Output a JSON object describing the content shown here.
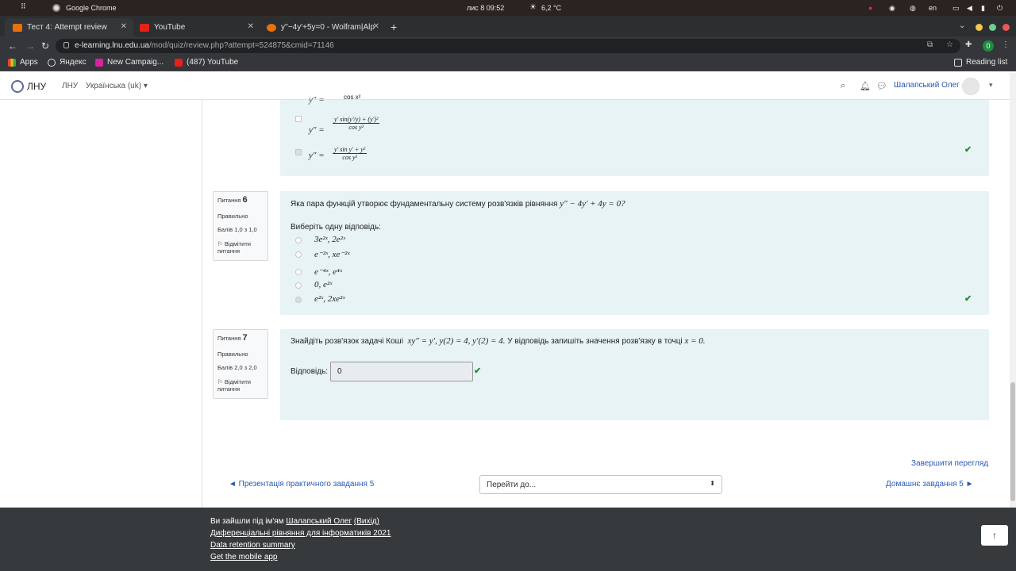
{
  "os": {
    "apps_label": "Google Chrome",
    "clock": "лис 8  09:52",
    "temp": "6,2 °C",
    "lang": "en"
  },
  "tabs": [
    {
      "title": "Тест 4: Attempt review",
      "color": "#e8710a"
    },
    {
      "title": "YouTube",
      "color": "#e62117"
    },
    {
      "title": "y''−4y'+5y=0 - Wolfram|Alp",
      "color": "#e8710a"
    }
  ],
  "address": {
    "host": "e-learning.lnu.edu.ua",
    "path": "/mod/quiz/review.php?attempt=524875&cmid=71146",
    "profile": "0"
  },
  "bookmarks": [
    {
      "label": "Apps",
      "icon": "apps-icon"
    },
    {
      "label": "Яндекс",
      "icon": "globe-icon"
    },
    {
      "label": "New Campaig...",
      "icon": "campaign-icon"
    },
    {
      "label": "(487) YouTube",
      "icon": "youtube-icon"
    }
  ],
  "reading_list": "Reading list",
  "navbar": {
    "brand": "ЛНУ",
    "link": "ЛНУ",
    "lang": "Українська (uk)",
    "user": "Шалапський Олег"
  },
  "q5": {
    "opt1": {
      "num": "y' sin(y'/y) + (y')²",
      "den": "cos y²"
    },
    "opt2": {
      "num": "y' sin y' + y²",
      "den": "cos y²"
    }
  },
  "q6": {
    "label": "Питання",
    "num": "6",
    "status": "Правильно",
    "score": "Балів 1,0 з 1,0",
    "flag": "Відмітити питання",
    "text": "Яка пара функцій утворює фундаментальну систему розв'язків рівняння",
    "equation": "y″ − 4y′ + 4y = 0?",
    "prompt": "Виберіть одну відповідь:",
    "options": [
      "3e²ˣ,  2e²ˣ",
      "e⁻²ˣ,  xe⁻²ˣ",
      "e⁻⁴ˣ,  e⁴ˣ",
      "0,  e²ˣ",
      "e²ˣ,  2xe²ˣ"
    ]
  },
  "q7": {
    "label": "Питання",
    "num": "7",
    "status": "Правильно",
    "score": "Балів 2,0 з 2,0",
    "flag": "Відмітити питання",
    "text_a": "Знайдіть розв'язок задачі Коші",
    "equation": "xy″ = y′,  y(2) = 4,  y′(2) = 4.",
    "text_b": "У відповідь запишіть значення розв'язку в точці",
    "point": "x = 0.",
    "answer_label": "Відповідь:",
    "answer": "0"
  },
  "nav": {
    "finish": "Завершити перегляд",
    "prev": "◄ Презентація практичного завдання 5",
    "jump": "Перейти до...",
    "next": "Домашнє завдання 5 ►"
  },
  "footer": {
    "logged_prefix": "Ви зайшли під ім'ям",
    "user": "Шалапський Олег",
    "logout": "(Вихід)",
    "course": "Диференціальні рівняння для інформатиків 2021",
    "retention": "Data retention summary",
    "mobile": "Get the mobile app"
  }
}
